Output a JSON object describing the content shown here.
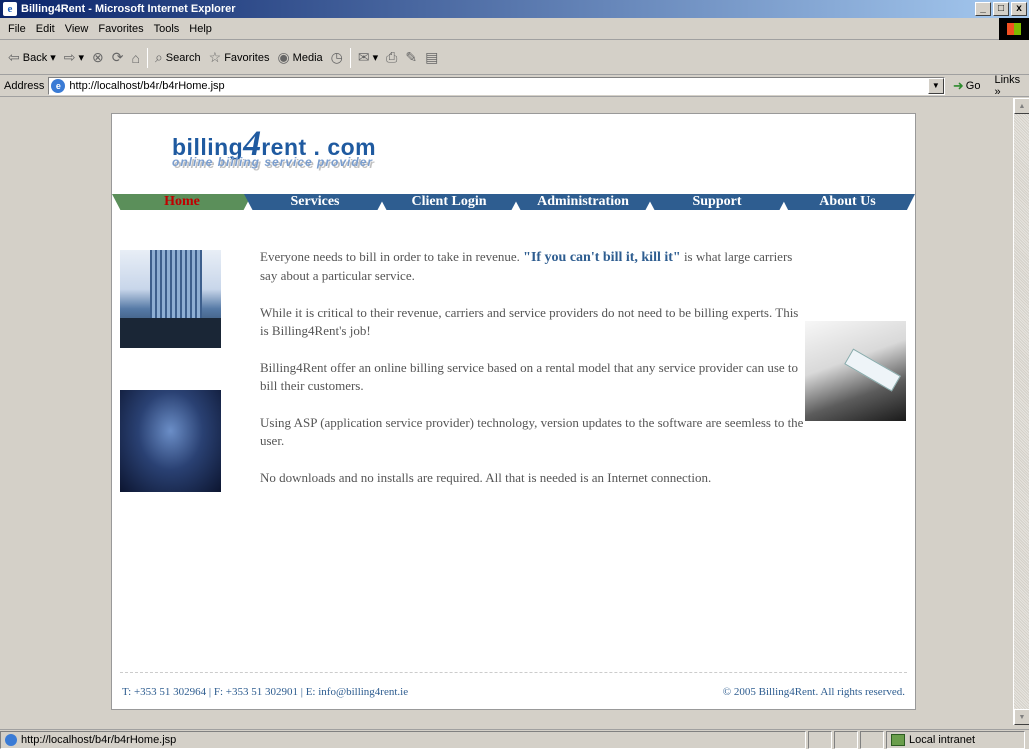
{
  "window": {
    "title": "Billing4Rent - Microsoft Internet Explorer",
    "buttons": [
      "_",
      "□",
      "x"
    ]
  },
  "menu": [
    "File",
    "Edit",
    "View",
    "Favorites",
    "Tools",
    "Help"
  ],
  "toolbar": {
    "back": "Back",
    "search": "Search",
    "favorites": "Favorites",
    "media": "Media"
  },
  "address": {
    "label": "Address",
    "url": "http://localhost/b4r/b4rHome.jsp",
    "go": "Go",
    "links": "Links"
  },
  "site": {
    "logo_main": "billing",
    "logo_four": "4",
    "logo_rest": "rent . com",
    "logo_tagline": "online billing service provider",
    "nav": [
      {
        "label": "Home",
        "active": true
      },
      {
        "label": "Services",
        "active": false
      },
      {
        "label": "Client Login",
        "active": false
      },
      {
        "label": "Administration",
        "active": false
      },
      {
        "label": "Support",
        "active": false
      },
      {
        "label": "About Us",
        "active": false
      }
    ],
    "paragraphs": {
      "p1_before": "Everyone needs to bill in order to take in revenue. ",
      "p1_quote": "\"If you can't bill it, kill it\"",
      "p1_after": " is what large carriers say about a particular service.",
      "p2": "While it is critical to their revenue, carriers and service providers do not need to be billing experts. This is Billing4Rent's job!",
      "p3": "Billing4Rent offer an online billing service based on a rental model that any service provider can use to bill their customers.",
      "p4": "Using ASP (application service provider) technology, version updates to the software are seemless to the user.",
      "p5": "No downloads and no installs are required. All that is needed is an Internet connection."
    },
    "footer_contact": "T: +353 51 302964 | F: +353 51 302901 | E: info@billing4rent.ie",
    "footer_copyright": "© 2005 Billing4Rent. All rights reserved."
  },
  "status": {
    "text": "http://localhost/b4r/b4rHome.jsp",
    "zone": "Local intranet"
  }
}
